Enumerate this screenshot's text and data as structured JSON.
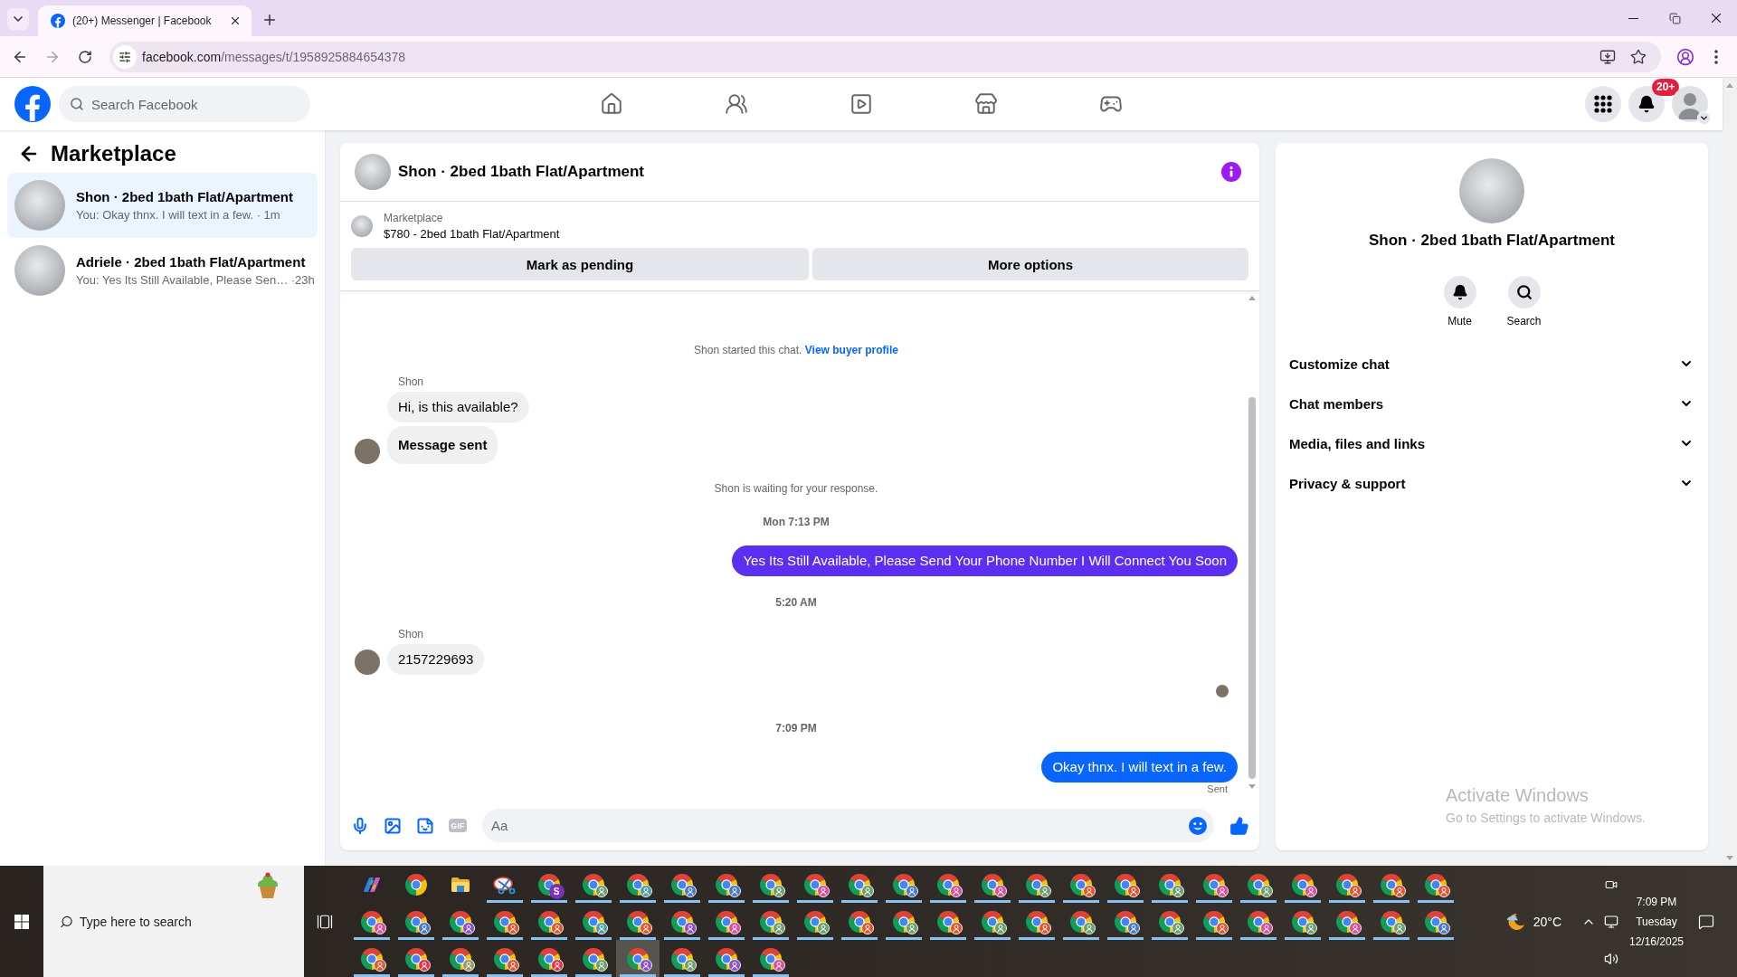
{
  "browser": {
    "tab": {
      "title": "(20+) Messenger | Facebook"
    },
    "url": {
      "host": "facebook.com",
      "path": "/messages/t/1958925884654378"
    }
  },
  "header": {
    "search": {
      "placeholder": "Search Facebook"
    },
    "nav": [
      {
        "kind": "home",
        "selected": false
      },
      {
        "kind": "friends",
        "selected": false
      },
      {
        "kind": "video",
        "selected": false
      },
      {
        "kind": "marketplace",
        "selected": false
      },
      {
        "kind": "gaming",
        "selected": false
      }
    ],
    "notifications": {
      "badge": "20+"
    }
  },
  "sidebar": {
    "title": "Marketplace",
    "conversations": [
      {
        "title": "Shon · 2bed 1bath Flat/Apartment",
        "preview": "You: Okay thnx. I will text in a few. · 1m",
        "selected": true
      },
      {
        "title": "Adriele · 2bed 1bath Flat/Apartment",
        "preview": "You: Yes Its Still Available, Please Sen… ·23h",
        "selected": false
      }
    ]
  },
  "chat": {
    "title": "Shon · 2bed 1bath Flat/Apartment",
    "listing": {
      "source": "Marketplace",
      "title": "$780 - 2bed 1bath Flat/Apartment"
    },
    "actions": [
      "Mark as pending",
      "More options"
    ],
    "messages": [
      {
        "kind": "notice",
        "text": "Shon started this chat.",
        "link": "View buyer profile"
      },
      {
        "kind": "received",
        "sender": "Shon",
        "bubbles": [
          {
            "text": "Hi, is this available?",
            "bold": false
          },
          {
            "text": "Message sent",
            "bold": true
          }
        ]
      },
      {
        "kind": "notice",
        "text": "Shon is waiting for your response."
      },
      {
        "kind": "time",
        "text": "Mon 7:13 PM"
      },
      {
        "kind": "sent",
        "text": "Yes Its Still Available, Please Send Your Phone Number I Will Connect You Soon",
        "color": "#5b2ff2"
      },
      {
        "kind": "time",
        "text": "5:20 AM"
      },
      {
        "kind": "received",
        "sender": "Shon",
        "bubbles": [
          {
            "text": "2157229693",
            "bold": false
          }
        ]
      },
      {
        "kind": "seen"
      },
      {
        "kind": "time",
        "text": "7:09 PM"
      },
      {
        "kind": "sent",
        "text": "Okay thnx. I will text in a few.",
        "color": "#0866ff",
        "status": "Sent"
      }
    ],
    "composer": {
      "tools": [
        {
          "kind": "mic"
        },
        {
          "kind": "photo"
        },
        {
          "kind": "sticker"
        },
        {
          "kind": "gif",
          "label": "GIF"
        }
      ],
      "placeholder": "Aa"
    }
  },
  "details": {
    "name": "Shon · 2bed 1bath Flat/Apartment",
    "actions": [
      {
        "kind": "mute",
        "label": "Mute"
      },
      {
        "kind": "search",
        "label": "Search"
      }
    ],
    "sections": [
      {
        "label": "Customize chat",
        "expanded": false
      },
      {
        "label": "Chat members",
        "expanded": false
      },
      {
        "label": "Media, files and links",
        "expanded": false
      },
      {
        "label": "Privacy & support",
        "expanded": false
      }
    ]
  },
  "activation_notice": {
    "title": "Activate Windows",
    "text": "Go to Settings to activate Windows."
  },
  "taskbar": {
    "search": {
      "placeholder": "Type here to search"
    },
    "apps": [
      {
        "kind": "copilot",
        "running": false,
        "selected": false
      },
      {
        "kind": "chrome",
        "running": false,
        "selected": false
      },
      {
        "kind": "files",
        "running": false,
        "selected": false
      },
      {
        "kind": "snipping",
        "running": true,
        "selected": false
      },
      {
        "kind": "profile",
        "color": "#7a2fb8",
        "initial": "S",
        "running": true,
        "selected": false
      },
      {
        "kind": "profile",
        "color": "#6e9e6e",
        "running": true,
        "selected": false
      },
      {
        "kind": "profile",
        "color": "#4f9fa8",
        "running": true,
        "selected": false
      },
      {
        "kind": "profile",
        "color": "#4a78c8",
        "running": true,
        "selected": false
      },
      {
        "kind": "profile",
        "color": "#4a78c8",
        "running": true,
        "selected": false
      },
      {
        "kind": "profile",
        "color": "#6ea06e",
        "running": true,
        "selected": false
      },
      {
        "kind": "profile",
        "color": "#d94f9a",
        "running": true,
        "selected": false
      },
      {
        "kind": "profile",
        "color": "#6ea06e",
        "running": true,
        "selected": false
      },
      {
        "kind": "profile",
        "color": "#4a78c8",
        "running": true,
        "selected": false
      },
      {
        "kind": "profile",
        "color": "#d94f9a",
        "running": true,
        "selected": false
      },
      {
        "kind": "profile",
        "color": "#d94f9a",
        "running": true,
        "selected": false
      },
      {
        "kind": "profile",
        "color": "#6ea06e",
        "running": true,
        "selected": false
      },
      {
        "kind": "profile",
        "color": "#e0552e",
        "running": true,
        "selected": false
      },
      {
        "kind": "profile",
        "color": "#e0552e",
        "running": true,
        "selected": false
      },
      {
        "kind": "profile",
        "color": "#6ea06e",
        "running": true,
        "selected": false
      },
      {
        "kind": "profile",
        "color": "#d94f9a",
        "running": true,
        "selected": false
      },
      {
        "kind": "profile",
        "color": "#6ea06e",
        "running": true,
        "selected": false
      },
      {
        "kind": "profile",
        "color": "#d94f9a",
        "running": true,
        "selected": false
      },
      {
        "kind": "profile",
        "color": "#e0552e",
        "running": true,
        "selected": false
      },
      {
        "kind": "profile",
        "color": "#e0552e",
        "running": true,
        "selected": false
      },
      {
        "kind": "profile",
        "color": "#e0552e",
        "running": true,
        "selected": false
      },
      {
        "kind": "profile",
        "color": "#d94f9a",
        "running": true,
        "selected": false
      },
      {
        "kind": "profile",
        "color": "#4a78c8",
        "running": true,
        "selected": false
      },
      {
        "kind": "profile",
        "color": "#8b4fc8",
        "running": true,
        "selected": false
      },
      {
        "kind": "profile",
        "color": "#e0552e",
        "running": true,
        "selected": false
      },
      {
        "kind": "profile",
        "color": "#e0552e",
        "running": true,
        "selected": false
      },
      {
        "kind": "profile",
        "color": "#4f9fa8",
        "running": true,
        "selected": false
      },
      {
        "kind": "profile",
        "color": "#e0552e",
        "running": true,
        "selected": false
      },
      {
        "kind": "profile",
        "color": "#8b4fc8",
        "running": true,
        "selected": false
      },
      {
        "kind": "profile",
        "color": "#d94f9a",
        "running": true,
        "selected": false
      },
      {
        "kind": "profile",
        "color": "#6ea06e",
        "running": true,
        "selected": false
      },
      {
        "kind": "profile",
        "color": "#6ea06e",
        "running": true,
        "selected": false
      },
      {
        "kind": "profile",
        "color": "#e0552e",
        "running": true,
        "selected": false
      },
      {
        "kind": "profile",
        "color": "#6ea06e",
        "running": true,
        "selected": false
      },
      {
        "kind": "profile",
        "color": "#e0552e",
        "running": true,
        "selected": false
      },
      {
        "kind": "profile",
        "color": "#6ea06e",
        "running": true,
        "selected": false
      },
      {
        "kind": "profile",
        "color": "#e0552e",
        "running": true,
        "selected": false
      },
      {
        "kind": "profile",
        "color": "#6ea06e",
        "running": true,
        "selected": false
      },
      {
        "kind": "profile",
        "color": "#4a78c8",
        "running": true,
        "selected": false
      },
      {
        "kind": "profile",
        "color": "#6ea06e",
        "running": true,
        "selected": false
      },
      {
        "kind": "profile",
        "color": "#e0552e",
        "running": true,
        "selected": false
      },
      {
        "kind": "profile",
        "color": "#d94f9a",
        "running": true,
        "selected": false
      },
      {
        "kind": "profile",
        "color": "#6ea06e",
        "running": true,
        "selected": false
      },
      {
        "kind": "profile",
        "color": "#d94f9a",
        "running": true,
        "selected": false
      },
      {
        "kind": "profile",
        "color": "#6ea06e",
        "running": true,
        "selected": false
      },
      {
        "kind": "profile",
        "color": "#4a78c8",
        "running": true,
        "selected": false
      },
      {
        "kind": "profile",
        "color": "#e0552e",
        "running": true,
        "selected": false
      },
      {
        "kind": "profile",
        "color": "#e0344a",
        "running": true,
        "selected": false
      },
      {
        "kind": "profile",
        "color": "#9c9a62",
        "running": true,
        "selected": false
      },
      {
        "kind": "profile",
        "color": "#e0552e",
        "running": true,
        "selected": false
      },
      {
        "kind": "profile",
        "color": "#e0344a",
        "running": true,
        "selected": false
      },
      {
        "kind": "profile",
        "color": "#6ea06e",
        "running": true,
        "selected": false
      },
      {
        "kind": "profile",
        "color": "#8b4fc8",
        "running": true,
        "selected": true
      },
      {
        "kind": "profile",
        "color": "#6ea06e",
        "running": true,
        "selected": false
      },
      {
        "kind": "profile",
        "color": "#8b4fc8",
        "running": true,
        "selected": false
      },
      {
        "kind": "profile",
        "color": "#d94f9a",
        "running": true,
        "selected": false
      }
    ],
    "weather": {
      "temperature": "20°C"
    },
    "clock": {
      "time": "7:09 PM",
      "day": "Tuesday",
      "date": "12/16/2025"
    }
  }
}
